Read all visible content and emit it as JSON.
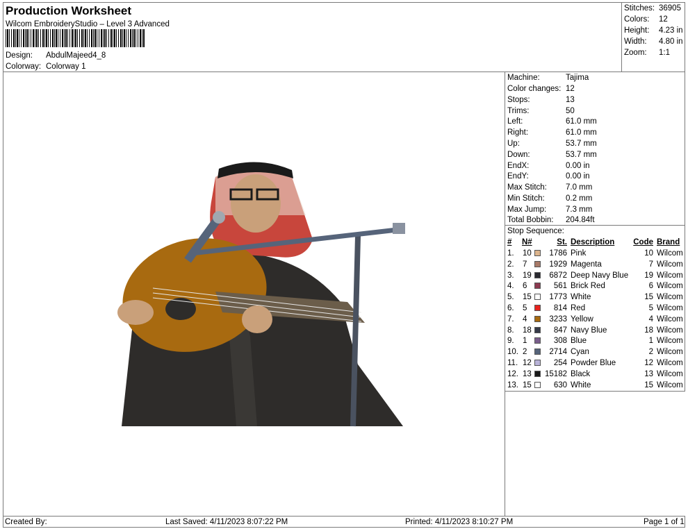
{
  "header": {
    "title": "Production Worksheet",
    "software": "Wilcom EmbroideryStudio – Level 3 Advanced",
    "design_label": "Design:",
    "design_value": "AbdulMajeed4_8",
    "colorway_label": "Colorway:",
    "colorway_value": "Colorway 1"
  },
  "summary": [
    {
      "label": "Stitches:",
      "value": "36905"
    },
    {
      "label": "Colors:",
      "value": "12"
    },
    {
      "label": "Height:",
      "value": "4.23 in"
    },
    {
      "label": "Width:",
      "value": "4.80 in"
    },
    {
      "label": "Zoom:",
      "value": "1:1"
    }
  ],
  "machine_info": [
    {
      "label": "Machine:",
      "value": "Tajima"
    },
    {
      "label": "Color changes:",
      "value": "12"
    },
    {
      "label": "Stops:",
      "value": "13"
    },
    {
      "label": "Trims:",
      "value": "50"
    },
    {
      "label": "Left:",
      "value": "61.0 mm"
    },
    {
      "label": "Right:",
      "value": "61.0 mm"
    },
    {
      "label": "Up:",
      "value": "53.7 mm"
    },
    {
      "label": "Down:",
      "value": "53.7 mm"
    },
    {
      "label": "EndX:",
      "value": "0.00 in"
    },
    {
      "label": "EndY:",
      "value": "0.00 in"
    },
    {
      "label": "Max Stitch:",
      "value": "7.0 mm"
    },
    {
      "label": "Min Stitch:",
      "value": "0.2 mm"
    },
    {
      "label": "Max Jump:",
      "value": "7.3 mm"
    },
    {
      "label": "Total Bobbin:",
      "value": "204.84ft"
    }
  ],
  "stop_sequence": {
    "label": "Stop Sequence:",
    "columns": {
      "num": "#",
      "n": "N#",
      "st": "St.",
      "description": "Description",
      "code": "Code",
      "brand": "Brand"
    },
    "rows": [
      {
        "num": "1.",
        "n": "10",
        "color": "#dcb48c",
        "st": "1786",
        "description": "Pink",
        "code": "10",
        "brand": "Wilcom"
      },
      {
        "num": "2.",
        "n": "7",
        "color": "#a87a68",
        "st": "1929",
        "description": "Magenta",
        "code": "7",
        "brand": "Wilcom"
      },
      {
        "num": "3.",
        "n": "19",
        "color": "#2a2a30",
        "st": "6872",
        "description": "Deep Navy Blue",
        "code": "19",
        "brand": "Wilcom"
      },
      {
        "num": "4.",
        "n": "6",
        "color": "#8c3a50",
        "st": "561",
        "description": "Brick Red",
        "code": "6",
        "brand": "Wilcom"
      },
      {
        "num": "5.",
        "n": "15",
        "color": "#ffffff",
        "st": "1773",
        "description": "White",
        "code": "15",
        "brand": "Wilcom"
      },
      {
        "num": "6.",
        "n": "5",
        "color": "#e8231e",
        "st": "814",
        "description": "Red",
        "code": "5",
        "brand": "Wilcom"
      },
      {
        "num": "7.",
        "n": "4",
        "color": "#a86a10",
        "st": "3233",
        "description": "Yellow",
        "code": "4",
        "brand": "Wilcom"
      },
      {
        "num": "8.",
        "n": "18",
        "color": "#363a48",
        "st": "847",
        "description": "Navy Blue",
        "code": "18",
        "brand": "Wilcom"
      },
      {
        "num": "9.",
        "n": "1",
        "color": "#7a5e8c",
        "st": "308",
        "description": "Blue",
        "code": "1",
        "brand": "Wilcom"
      },
      {
        "num": "10.",
        "n": "2",
        "color": "#56647a",
        "st": "2714",
        "description": "Cyan",
        "code": "2",
        "brand": "Wilcom"
      },
      {
        "num": "11.",
        "n": "12",
        "color": "#b8b2d8",
        "st": "254",
        "description": "Powder Blue",
        "code": "12",
        "brand": "Wilcom"
      },
      {
        "num": "12.",
        "n": "13",
        "color": "#1a1a1a",
        "st": "15182",
        "description": "Black",
        "code": "13",
        "brand": "Wilcom"
      },
      {
        "num": "13.",
        "n": "15",
        "color": "#ffffff",
        "st": "630",
        "description": "White",
        "code": "15",
        "brand": "Wilcom"
      }
    ]
  },
  "footer": {
    "created_by": "Created By:",
    "last_saved": "Last Saved: 4/11/2023 8:07:22 PM",
    "printed": "Printed: 4/11/2023 8:10:27 PM",
    "page": "Page 1 of 1"
  }
}
